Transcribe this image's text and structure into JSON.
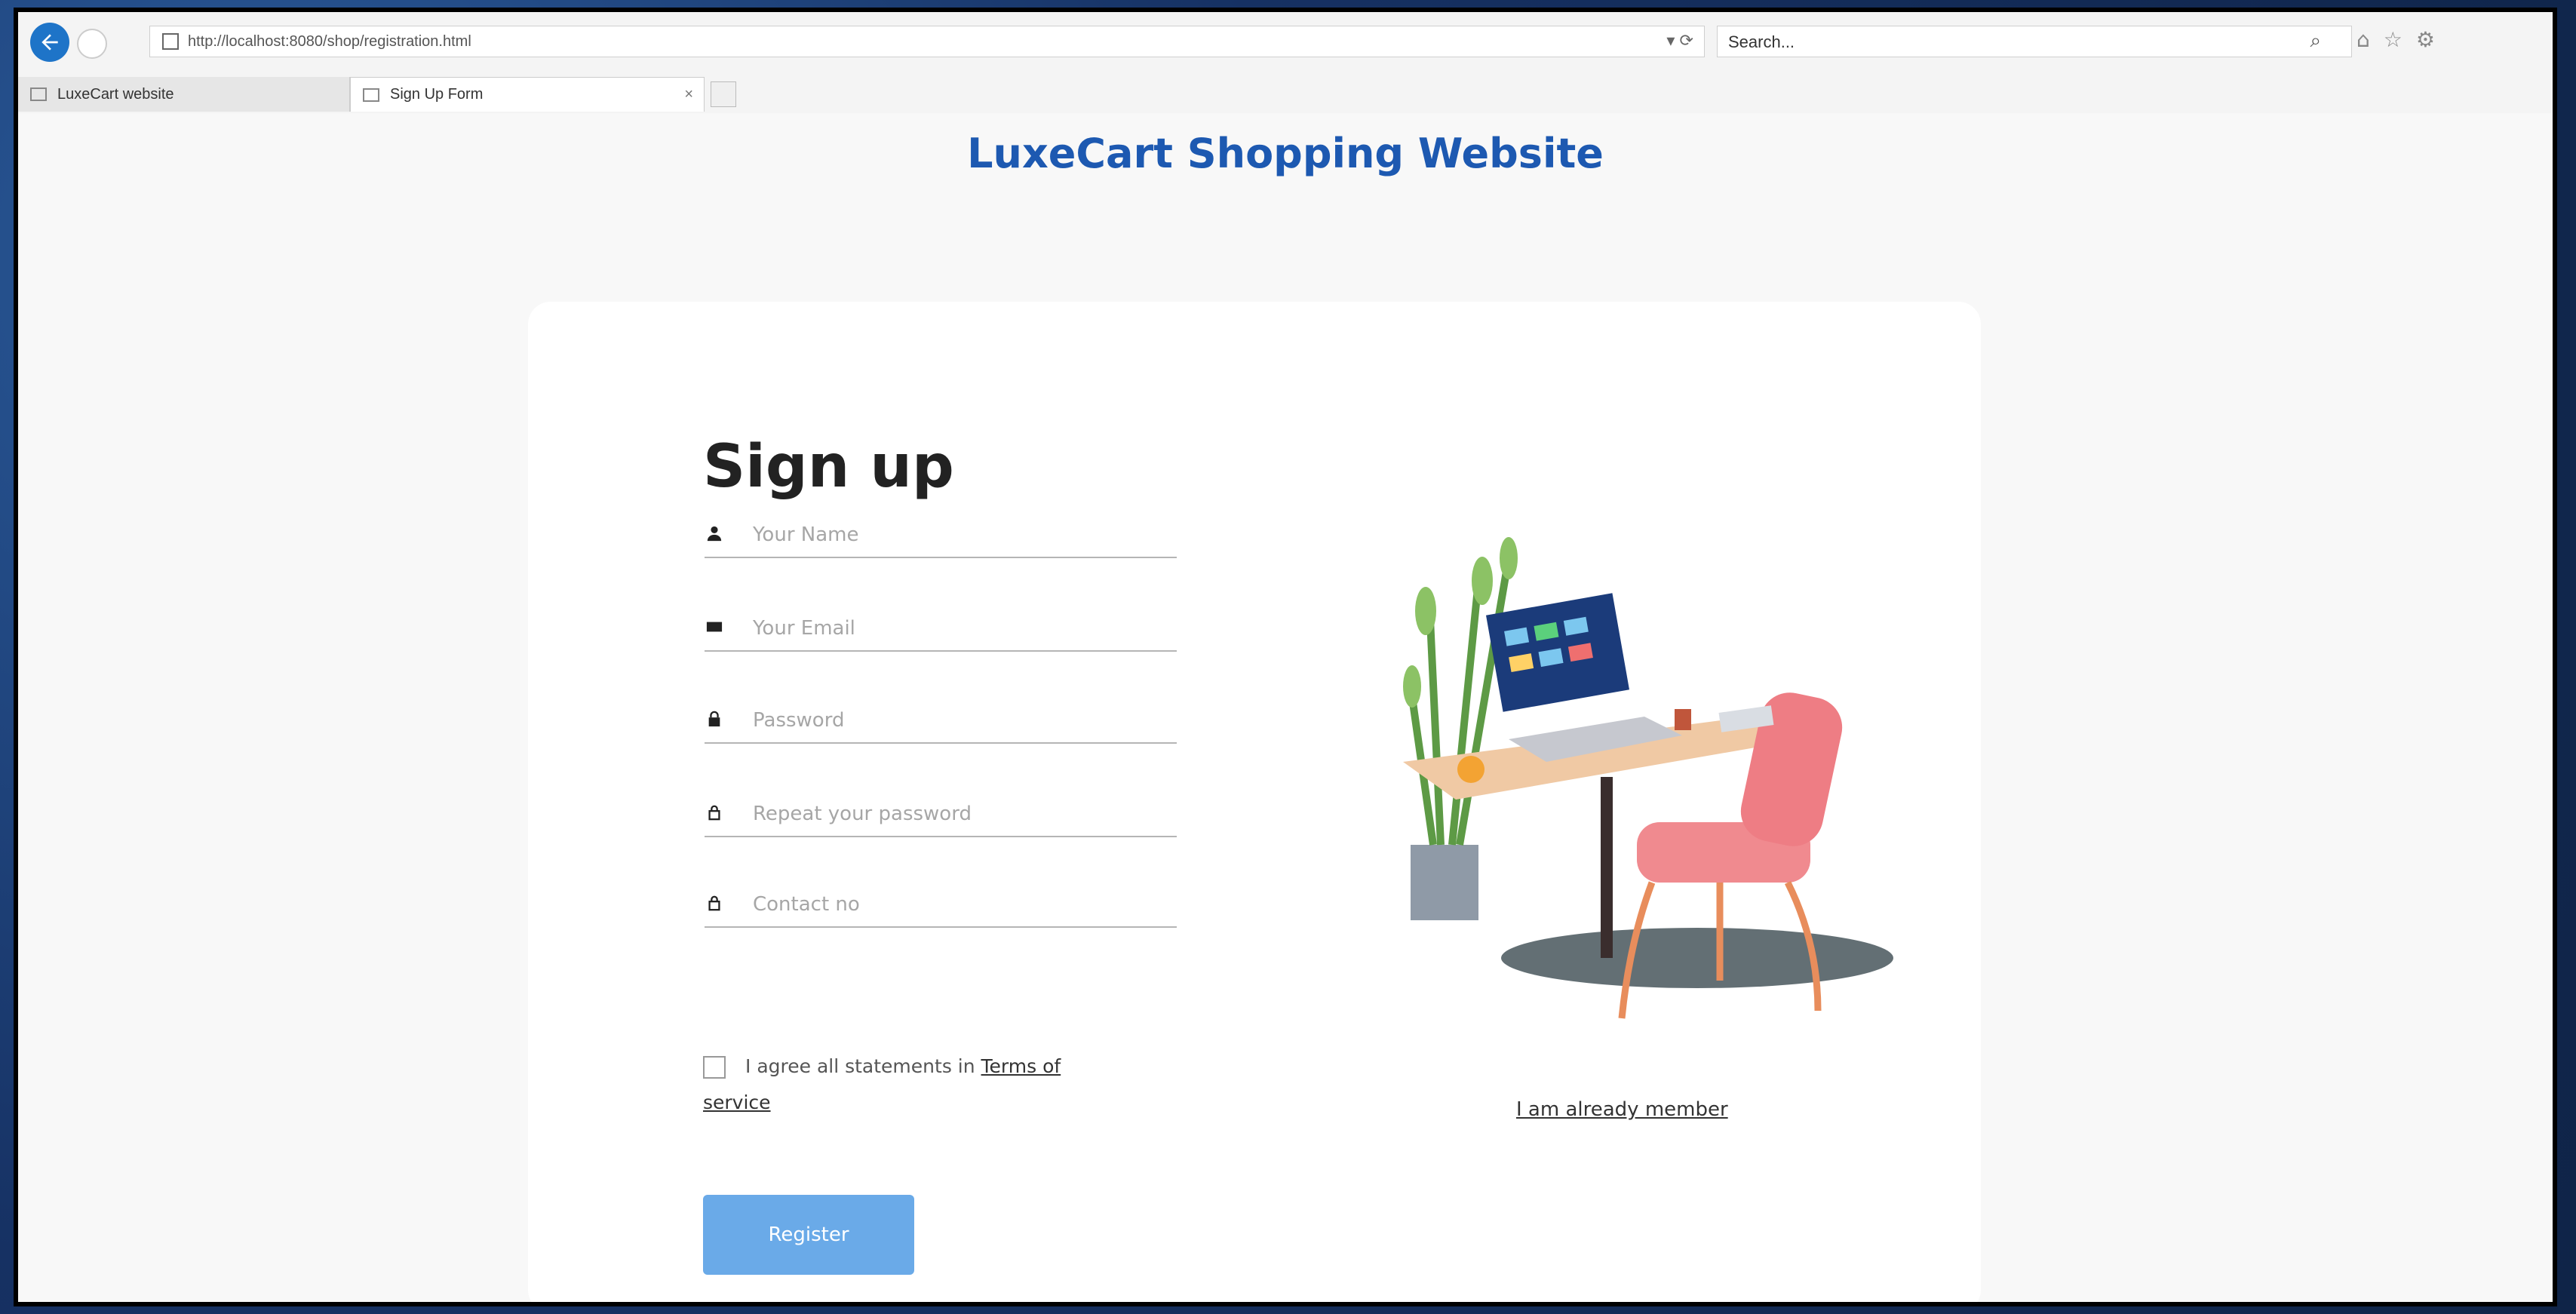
{
  "browser": {
    "url": "http://localhost:8080/shop/registration.html",
    "url_controls": "▾ ⟳",
    "search_placeholder": "Search...",
    "tabs": [
      {
        "label": "LuxeCart website"
      },
      {
        "label": "Sign Up Form"
      }
    ],
    "tab_close": "×"
  },
  "page": {
    "site_title": "LuxeCart Shopping Website",
    "heading": "Sign up",
    "fields": {
      "name_placeholder": "Your Name",
      "email_placeholder": "Your Email",
      "password_placeholder": "Password",
      "repeat_placeholder": "Repeat your password",
      "contact_placeholder": "Contact no"
    },
    "agree_text": "I agree all statements in ",
    "terms_link": "Terms of service",
    "register_label": "Register",
    "member_link": "I am already member"
  },
  "colors": {
    "title_blue": "#1d59b1",
    "button_blue": "#6aaae8",
    "back_button": "#1e74c8"
  }
}
